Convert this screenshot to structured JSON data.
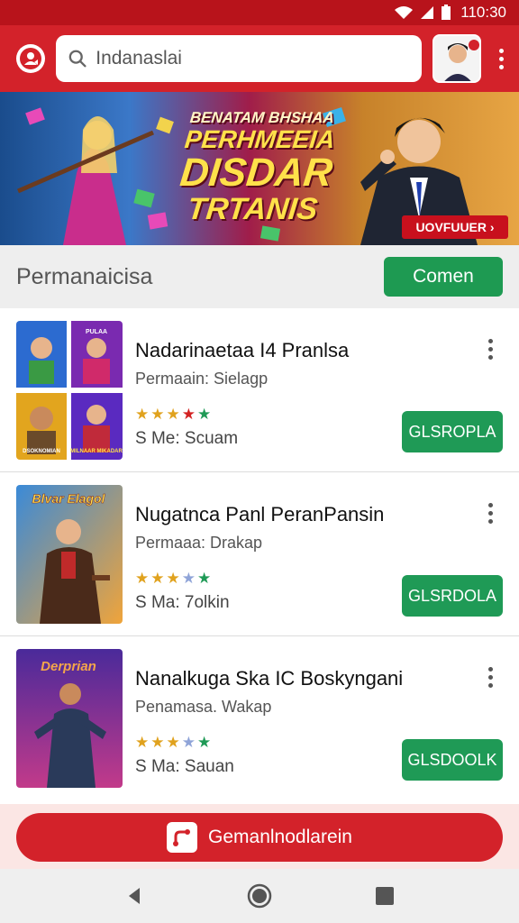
{
  "status_bar": {
    "time": "110:30"
  },
  "header": {
    "search": {
      "value": "Indanaslai",
      "placeholder": "Indanaslai"
    }
  },
  "banner": {
    "line1": "BENATAM BHSHAA",
    "line2": "PERHMEEIA",
    "line3": "DISDAR",
    "line4": "TRTANIS",
    "cta": "UOVFUUER ›"
  },
  "section": {
    "title": "Permanaicisa",
    "button": "Comen"
  },
  "items": [
    {
      "title": "Nadarinaetaa I4 Pranlsa",
      "subtitle": "Permaain: Sielagp",
      "meta": "S Me: Scuam",
      "action": "GLSROPLA",
      "star_colors": [
        "#e0a21e",
        "#e0a21e",
        "#e0a21e",
        "#d32222",
        "#1f9a56"
      ],
      "thumb_labels": [
        "",
        "PULAA",
        "",
        "DSOKNOMIAN",
        "MILNAAR\nMIKADAR"
      ]
    },
    {
      "title": "Nugatnca Panl PeranPansin",
      "subtitle": "Permaaa: Drakap",
      "meta": "S Ma: 7olkin",
      "action": "GLSRDOLA",
      "star_colors": [
        "#e0a21e",
        "#e0a21e",
        "#e0a21e",
        "#8fa4d8",
        "#1f9a56"
      ],
      "thumb_labels": [
        "Blvar Elagol"
      ]
    },
    {
      "title": "Nanalkuga Ska IC Boskyngani",
      "subtitle": "Penamasa. Wakap",
      "meta": "S Ma: Sauan",
      "action": "GLSDOOLK",
      "star_colors": [
        "#e0a21e",
        "#e0a21e",
        "#e0a21e",
        "#8fa4d8",
        "#1f9a56"
      ],
      "thumb_labels": [
        "Derprian"
      ]
    }
  ],
  "footer": {
    "cta": "Gemanlnodlarein"
  },
  "icons": {
    "logo": "user-location-icon",
    "search": "search-icon",
    "menu": "more-vert-icon",
    "back": "back-icon",
    "home": "home-icon",
    "recents": "recents-icon"
  },
  "colors": {
    "primary": "#d3222a",
    "accent_green": "#1e9a52"
  }
}
